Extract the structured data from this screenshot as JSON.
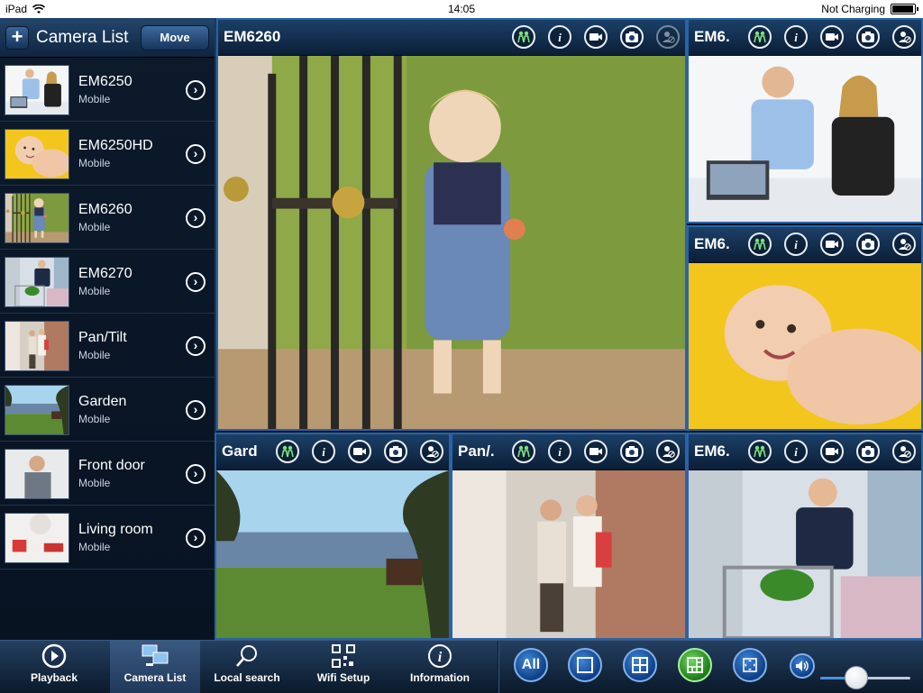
{
  "status_bar": {
    "device": "iPad",
    "time": "14:05",
    "charging": "Not Charging",
    "battery_level": 0.95
  },
  "sidebar": {
    "title": "Camera List",
    "move_label": "Move",
    "add_label": "+",
    "cameras": [
      {
        "name": "EM6250",
        "sub": "Mobile",
        "thumb": "office"
      },
      {
        "name": "EM6250HD",
        "sub": "Mobile",
        "thumb": "baby"
      },
      {
        "name": "EM6260",
        "sub": "Mobile",
        "thumb": "gate"
      },
      {
        "name": "EM6270",
        "sub": "Mobile",
        "thumb": "store"
      },
      {
        "name": "Pan/Tilt",
        "sub": "Mobile",
        "thumb": "mall"
      },
      {
        "name": "Garden",
        "sub": "Mobile",
        "thumb": "landscape"
      },
      {
        "name": "Front door",
        "sub": "Mobile",
        "thumb": "door"
      },
      {
        "name": "Living room",
        "sub": "Mobile",
        "thumb": "room"
      }
    ]
  },
  "panes": [
    {
      "title": "EM6260",
      "scene": "gate"
    },
    {
      "title": "EM6.",
      "scene": "office"
    },
    {
      "title": "EM6.",
      "scene": "baby"
    },
    {
      "title": "Gard",
      "scene": "landscape"
    },
    {
      "title": "Pan/.",
      "scene": "mall"
    },
    {
      "title": "EM6.",
      "scene": "store"
    }
  ],
  "toolbar": {
    "items": [
      {
        "label": "Playback",
        "icon": "playback-icon"
      },
      {
        "label": "Camera List",
        "icon": "camera-list-icon"
      },
      {
        "label": "Local search",
        "icon": "search-icon"
      },
      {
        "label": "Wifi Setup",
        "icon": "qr-code-icon"
      },
      {
        "label": "Information",
        "icon": "info-icon"
      }
    ],
    "active": "Camera List",
    "layout_all_label": "All",
    "volume": 0.4
  },
  "colors": {
    "accent": "#2a63a8",
    "active_layout": "#2f9a27",
    "background": "#0a1626"
  }
}
